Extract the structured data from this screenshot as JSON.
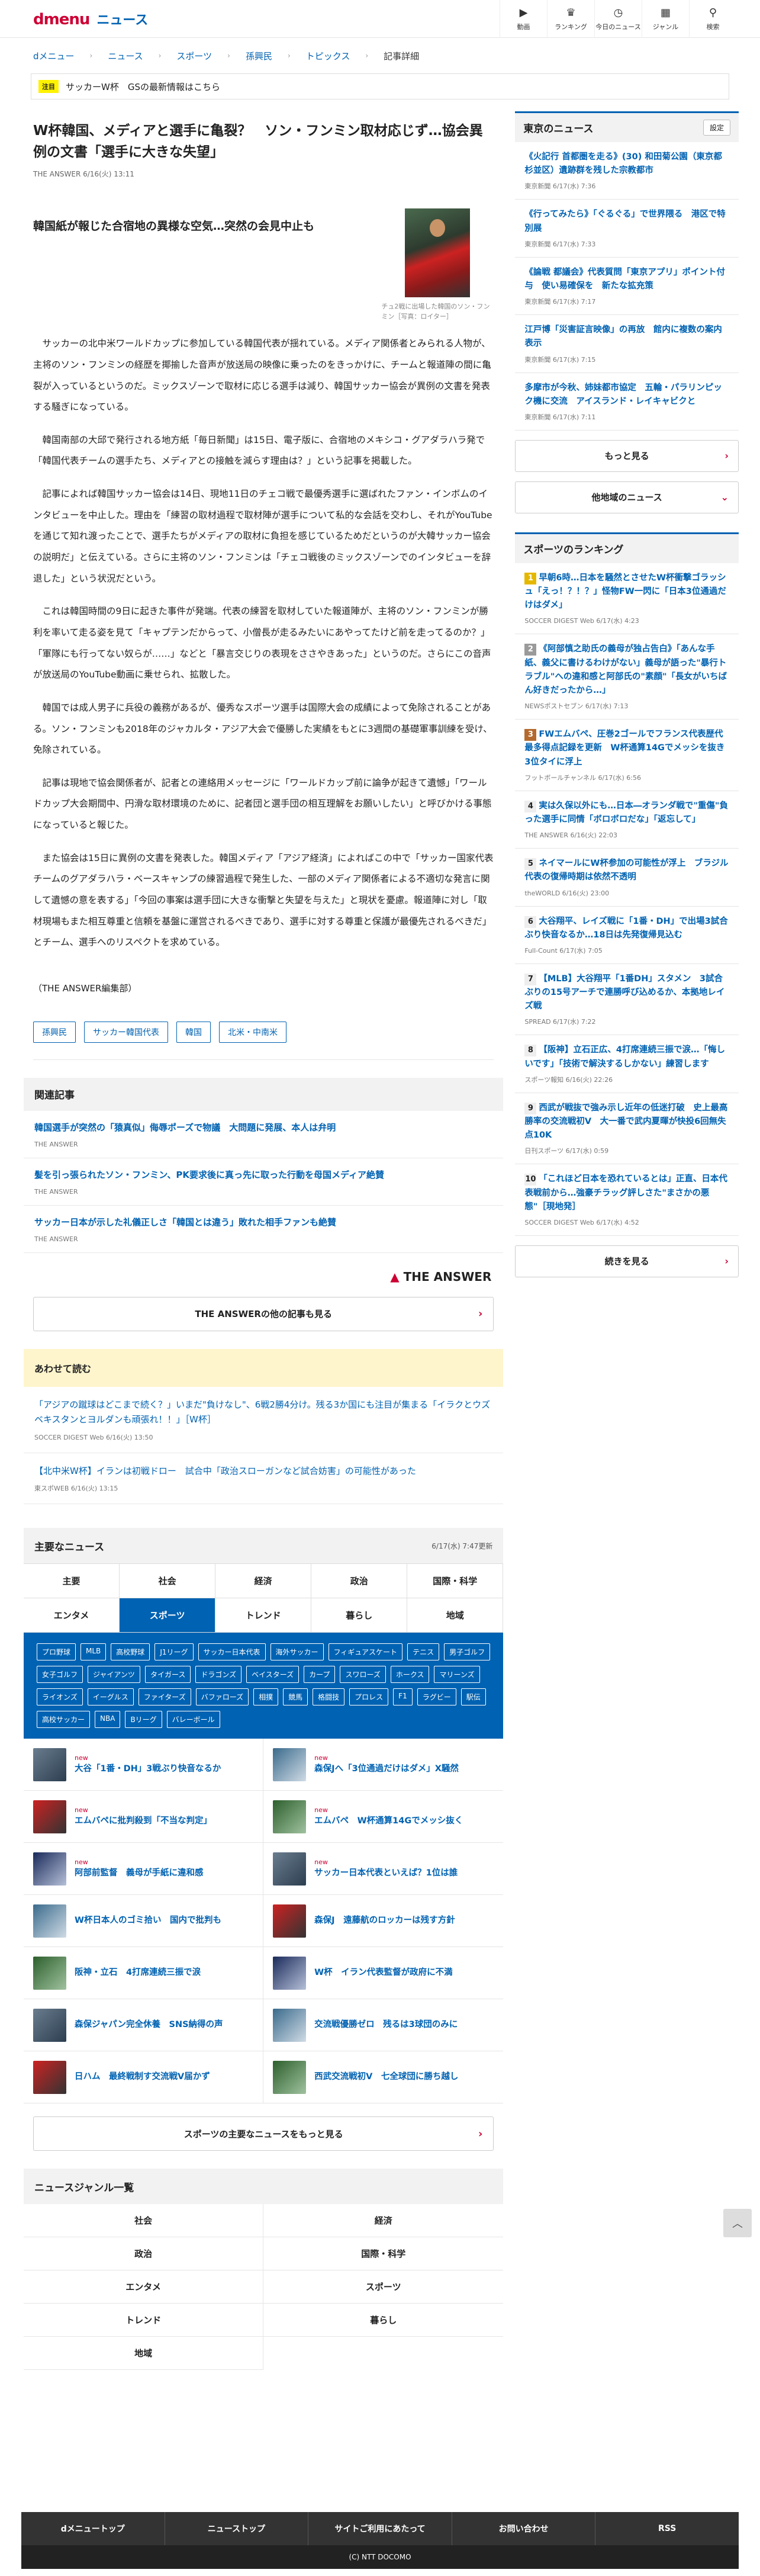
{
  "header": {
    "logo_d": "dmenu",
    "logo_news": "ニュース",
    "icons": [
      {
        "label": "動画",
        "icon": "video-icon",
        "glyph": "▶"
      },
      {
        "label": "ランキング",
        "icon": "ranking-icon",
        "glyph": "♛"
      },
      {
        "label": "今日のニュース",
        "icon": "clock-icon",
        "glyph": "◷"
      },
      {
        "label": "ジャンル",
        "icon": "grid-icon",
        "glyph": "▦"
      },
      {
        "label": "検索",
        "icon": "search-icon",
        "glyph": "⚲"
      }
    ]
  },
  "breadcrumb": [
    "dメニュー",
    "ニュース",
    "スポーツ",
    "孫興民",
    "トピックス",
    "記事詳細"
  ],
  "notice": {
    "badge": "注目",
    "text": "サッカーW杯　GSの最新情報はこちら"
  },
  "article": {
    "title": "W杯韓国、メディアと選手に亀裂？　ソン・フンミン取材応じず…協会異例の文書「選手に大きな失望」",
    "meta": "THE ANSWER 6/16(火) 13:11",
    "subhead": "韓国紙が報じた合宿地の異様な空気…突然の会見中止も",
    "photo_caption": "チュ2戦に出場した韓国のソン・フンミン［写真：ロイター］",
    "paragraphs": [
      "サッカーの北中米ワールドカップに参加している韓国代表が揺れている。メディア関係者とみられる人物が、主将のソン・フンミンの経歴を揶揄した音声が放送局の映像に乗ったのをきっかけに、チームと報道陣の間に亀裂が入っているというのだ。ミックスゾーンで取材に応じる選手は減り、韓国サッカー協会が異例の文書を発表する騒ぎになっている。",
      "韓国南部の大邱で発行される地方紙「毎日新聞」は15日、電子版に、合宿地のメキシコ・グアダラハラ発で「韓国代表チームの選手たち、メディアとの接触を減らす理由は？」という記事を掲載した。",
      "記事によれば韓国サッカー協会は14日、現地11日のチェコ戦で最優秀選手に選ばれたファン・インボムのインタビューを中止した。理由を「練習の取材過程で取材陣が選手について私的な会話を交わし、それがYouTubeを通じて知れ渡ったことで、選手たちがメディアの取材に負担を感じているためだというのが大韓サッカー協会の説明だ」と伝えている。さらに主将のソン・フンミンは「チェコ戦後のミックスゾーンでのインタビューを辞退した」という状況だという。",
      "これは韓国時間の9日に起きた事件が発端。代表の練習を取材していた報道陣が、主将のソン・フンミンが勝利を率いて走る姿を見て「キャプテンだからって、小僧長が走るみたいにあやってたけど前を走ってるのか？」「軍隊にも行ってない奴らが……」などと「暴言交じりの表現をささやきあった」というのだ。さらにこの音声が放送局のYouTube動画に乗せられ、拡散した。",
      "韓国では成人男子に兵役の義務があるが、優秀なスポーツ選手は国際大会の成績によって免除されることがある。ソン・フンミンも2018年のジャカルタ・アジア大会で優勝した実績をもとに3週間の基礎軍事訓練を受け、免除されている。",
      "記事は現地で協会関係者が、記者との連絡用メッセージに「ワールドカップ前に論争が起きて遺憾」「ワールドカップ大会期間中、円滑な取材環境のために、記者団と選手団の相互理解をお願いしたい」と呼びかける事態になっていると報じた。",
      "また協会は15日に異例の文書を発表した。韓国メディア「アジア経済」によればこの中で「サッカー国家代表チームのグアダラハラ・ベースキャンプの練習過程で発生した、一部のメディア関係者による不適切な発言に関して遺憾の意を表する」「今回の事案は選手団に大きな衝撃と失望を与えた」と現状を憂慮。報道陣に対し「取材現場もまた相互尊重と信頼を基盤に運営されるべきであり、選手に対する尊重と保護が最優先されるべきだ」とチーム、選手へのリスペクトを求めている。"
    ],
    "credit": "（THE ANSWER編集部）",
    "tags": [
      "孫興民",
      "サッカー韓国代表",
      "韓国",
      "北米・中南米"
    ]
  },
  "related": {
    "heading": "関連記事",
    "items": [
      {
        "title": "韓国選手が突然の「猿真似」侮辱ポーズで物議　大問題に発展、本人は弁明",
        "source": "THE ANSWER"
      },
      {
        "title": "髪を引っ張られたソン・フンミン、PK要求後に真っ先に取った行動を母国メディア絶賛",
        "source": "THE ANSWER"
      },
      {
        "title": "サッカー日本が示した礼儀正しさ「韓国とは違う」敗れた相手ファンも絶賛",
        "source": "THE ANSWER"
      }
    ],
    "brand": "THE ANSWER",
    "more_label": "THE ANSWERの他の記事も見る"
  },
  "also": {
    "heading": "あわせて読む",
    "items": [
      {
        "title": "「アジアの蹴球はどこまで続く？」いまだ\"負けなし\"、6戦2勝4分け。残る3か国にも注目が集まる「イラクとウズベキスタンとヨルダンも頑張れ！！」［W杯］",
        "source": "SOCCER DIGEST Web 6/16(火) 13:50"
      },
      {
        "title": "【北中米W杯】イランは初戦ドロー　試合中「政治スローガンなど試合妨害」の可能性があった",
        "source": "東スポWEB 6/16(火) 13:15"
      }
    ]
  },
  "major": {
    "heading": "主要なニュース",
    "updated": "6/17(水) 7:47更新",
    "categories": [
      "主要",
      "社会",
      "経済",
      "政治",
      "国際・科学",
      "エンタメ",
      "スポーツ",
      "トレンド",
      "暮らし",
      "地域"
    ],
    "active_category": 6,
    "subcategories": [
      "プロ野球",
      "MLB",
      "高校野球",
      "J1リーグ",
      "サッカー日本代表",
      "海外サッカー",
      "フィギュアスケート",
      "テニス",
      "男子ゴルフ",
      "女子ゴルフ",
      "ジャイアンツ",
      "タイガース",
      "ドラゴンズ",
      "ベイスターズ",
      "カープ",
      "スワローズ",
      "ホークス",
      "マリーンズ",
      "ライオンズ",
      "イーグルス",
      "ファイターズ",
      "バファローズ",
      "相撲",
      "競馬",
      "格闘技",
      "プロレス",
      "F1",
      "ラグビー",
      "駅伝",
      "高校サッカー",
      "NBA",
      "Bリーグ",
      "バレーボール"
    ],
    "news": [
      {
        "title": "大谷「1番・DH」3戦ぶり快音なるか",
        "new": "new"
      },
      {
        "title": "森保Jへ「3位通過だけはダメ」X騒然",
        "new": "new"
      },
      {
        "title": "エムバペに批判殺到「不当な判定」",
        "new": "new"
      },
      {
        "title": "エムバペ　W杯通算14Gでメッシ抜く",
        "new": "new"
      },
      {
        "title": "阿部前監督　義母が手紙に違和感",
        "new": "new"
      },
      {
        "title": "サッカー日本代表といえば？1位は誰",
        "new": "new"
      },
      {
        "title": "W杯日本人のゴミ拾い　国内で批判も",
        "new": ""
      },
      {
        "title": "森保J　遠藤航のロッカーは残す方針",
        "new": ""
      },
      {
        "title": "阪神・立石　4打席連続三振で涙",
        "new": ""
      },
      {
        "title": "W杯　イラン代表監督が政府に不満",
        "new": ""
      },
      {
        "title": "森保ジャパン完全休養　SNS納得の声",
        "new": ""
      },
      {
        "title": "交流戦優勝ゼロ　残るは3球団のみに",
        "new": ""
      },
      {
        "title": "日ハム　最終戦制す交流戦V届かず",
        "new": ""
      },
      {
        "title": "西武交流戦初V　七全球団に勝ち越し",
        "new": ""
      }
    ],
    "more_label": "スポーツの主要なニュースをもっと見る"
  },
  "genres": {
    "heading": "ニュースジャンル一覧",
    "items": [
      "社会",
      "経済",
      "政治",
      "国際・科学",
      "エンタメ",
      "スポーツ",
      "トレンド",
      "暮らし",
      "地域"
    ]
  },
  "sidebar": {
    "tokyo": {
      "heading": "東京のニュース",
      "settings_label": "設定",
      "items": [
        {
          "title": "《火記行 首都圏を走る》(30) 和田菊公園（東京都杉並区）遺跡群を残した宗教都市",
          "source": "東京新聞 6/17(水) 7:36"
        },
        {
          "title": "《行ってみたら》「ぐるぐる」で世界隈る　港区で特別展",
          "source": "東京新聞 6/17(水) 7:33"
        },
        {
          "title": "《論戦 都議会》代表質問「東京アプリ」ポイント付与　使い易確保を　新たな拡充策",
          "source": "東京新聞 6/17(水) 7:17"
        },
        {
          "title": "江戸博「災害証言映像」の再放　館内に複数の案内表示",
          "source": "東京新聞 6/17(水) 7:15"
        },
        {
          "title": "多摩市が今秋、姉妹都市協定　五輪・パラリンピック機に交流　アイスランド・レイキャビクと",
          "source": "東京新聞 6/17(水) 7:11"
        }
      ],
      "more_label": "もっと見る",
      "other_label": "他地域のニュース"
    },
    "ranking": {
      "heading": "スポーツのランキング",
      "items": [
        {
          "title": "早朝6時…日本を騒然とさせたW杯衝撃ゴラッシュ「えっ！？！？」怪物FW一閃に「日本3位通過だけはダメ」",
          "source": "SOCCER DIGEST Web 6/17(水) 4:23"
        },
        {
          "title": "《阿部慎之助氏の義母が独占告白》「あんな手紙、義父に書けるわけがない」義母が語った\"暴行トラブル\"への違和感と阿部氏の\"素顔\"「長女がいちばん好きだったから…」",
          "source": "NEWSポストセブン 6/17(水) 7:13"
        },
        {
          "title": "FWエムバペ、圧巻2ゴールでフランス代表歴代最多得点記録を更新　W杯通算14Gでメッシを抜き3位タイに浮上",
          "source": "フットボールチャンネル 6/17(水) 6:56"
        },
        {
          "title": "実は久保以外にも…日本―オランダ戦で\"重傷\"負った選手に同情「ボロボロだな」「返忘して」",
          "source": "THE ANSWER 6/16(火) 22:03"
        },
        {
          "title": "ネイマールにW杯参加の可能性が浮上　ブラジル代表の復帰時期は依然不透明",
          "source": "theWORLD 6/16(火) 23:00"
        },
        {
          "title": "大谷翔平、レイズ戦に「1番・DH」で出場3試合ぶり快音なるか…18日は先発復帰見込む",
          "source": "Full-Count 6/17(水) 7:05"
        },
        {
          "title": "【MLB】大谷翔平「1番DH」スタメン　3試合ぶりの15号アーチで連勝呼び込めるか、本拠地レイズ戦",
          "source": "SPREAD 6/17(水) 7:22"
        },
        {
          "title": "【阪神】立石正広、4打席連続三振で涙…「悔しいです」「技術で解決するしかない」練習します",
          "source": "スポーツ報知 6/16(火) 22:26"
        },
        {
          "title": "西武が戦抜で強み示し近年の低迷打破　史上最高勝率の交流戦初V　大一番で武内夏暉が快投6回無失点10K",
          "source": "日刊スポーツ 6/17(水) 0:59"
        },
        {
          "title": "「これほど日本を恐れているとは」正直、日本代表戦前から…強豪チラッグ評しさた\"まさかの悪態\"［現地発］",
          "source": "SOCCER DIGEST Web 6/17(水) 4:52"
        }
      ],
      "more_label": "続きを見る"
    }
  },
  "footer": {
    "nav": [
      "dメニュートップ",
      "ニューストップ",
      "サイトご利用にあたって",
      "お問い合わせ",
      "RSS"
    ],
    "copyright": "(C) NTT DOCOMO",
    "pagetop": "︿"
  }
}
